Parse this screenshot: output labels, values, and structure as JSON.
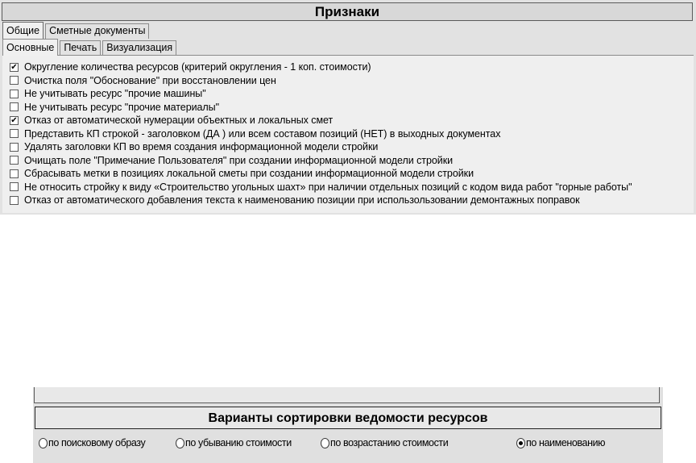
{
  "top_panel": {
    "title": "Признаки",
    "tabs_row1": [
      {
        "label": "Общие",
        "active": true
      },
      {
        "label": "Сметные документы",
        "active": false
      }
    ],
    "tabs_row2": [
      {
        "label": "Основные",
        "active": true
      },
      {
        "label": "Печать",
        "active": false
      },
      {
        "label": "Визуализация",
        "active": false
      }
    ],
    "checkboxes": [
      {
        "label": "Округление количества ресурсов (критерий округления - 1 коп. стоимости)",
        "checked": true
      },
      {
        "label": "Очистка поля \"Обоснование\" при восстановлении цен",
        "checked": false
      },
      {
        "label": "Не учитывать ресурс \"прочие машины\"",
        "checked": false
      },
      {
        "label": "Не учитывать ресурс \"прочие материалы\"",
        "checked": false
      },
      {
        "label": "Отказ от автоматической нумерации объектных и локальных смет",
        "checked": true
      },
      {
        "label": "Представить КП строкой - заголовком (ДА ) или всем составом позиций (НЕТ) в выходных документах",
        "checked": false
      },
      {
        "label": "Удалять заголовки КП во время создания информационной модели стройки",
        "checked": false
      },
      {
        "label": "Очищать поле \"Примечание Пользователя\" при создании  информационной модели стройки",
        "checked": false
      },
      {
        "label": "Сбрасывать метки в позициях локальной сметы при создании  информационной модели стройки",
        "checked": false
      },
      {
        "label": "Не относить стройку к виду «Строительство угольных шахт» при наличии отдельных позиций с кодом вида работ  \"горные работы\"",
        "checked": false
      },
      {
        "label": "Отказ от автоматического добавления текста к наименованию позиции при использользовании  демонтажных поправок",
        "checked": false
      }
    ]
  },
  "sort_panel": {
    "title": "Варианты сортировки ведомости ресурсов",
    "options": [
      {
        "label": "по поисковому образу",
        "selected": false
      },
      {
        "label": "по убыванию стоимости",
        "selected": false
      },
      {
        "label": "по возрастанию стоимости",
        "selected": false
      },
      {
        "label": "по наименованию",
        "selected": true
      }
    ]
  },
  "icons": {
    "check_mark": "✔"
  }
}
